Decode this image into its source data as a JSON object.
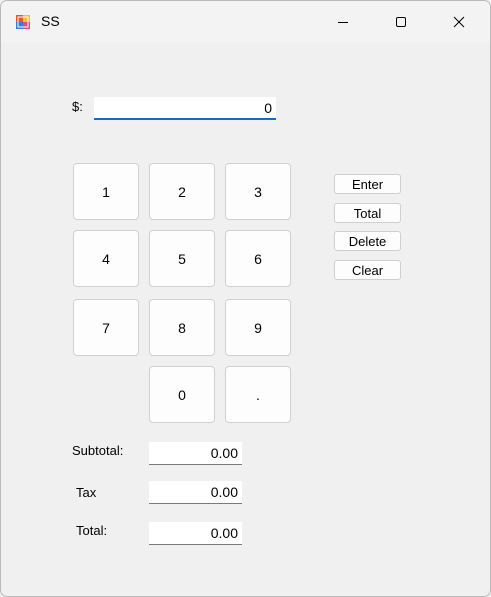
{
  "window": {
    "title": "SS"
  },
  "entry": {
    "label": "$:",
    "value": "0"
  },
  "keypad": {
    "k1": "1",
    "k2": "2",
    "k3": "3",
    "k4": "4",
    "k5": "5",
    "k6": "6",
    "k7": "7",
    "k8": "8",
    "k9": "9",
    "k0": "0",
    "kdot": "."
  },
  "actions": {
    "enter": "Enter",
    "total": "Total",
    "delete": "Delete",
    "clear": "Clear"
  },
  "summary": {
    "subtotal_label": "Subtotal:",
    "subtotal_value": "0.00",
    "tax_label": "Tax",
    "tax_value": "0.00",
    "total_label": "Total:",
    "total_value": "0.00"
  },
  "colors": {
    "input_underline": "#1a66c9",
    "window_bg": "#f0f0f0"
  },
  "icons": [
    "app-icon",
    "minimize-icon",
    "maximize-icon",
    "close-icon"
  ]
}
